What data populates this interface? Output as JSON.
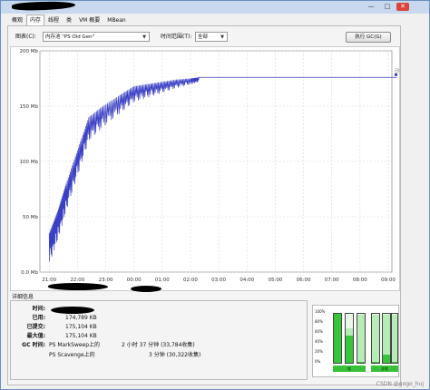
{
  "window": {
    "minimize": "—",
    "maximize": "□",
    "close": "✕"
  },
  "tabs": [
    {
      "label": "概观",
      "active": false
    },
    {
      "label": "内存",
      "active": true
    },
    {
      "label": "线程",
      "active": false
    },
    {
      "label": "类",
      "active": false
    },
    {
      "label": "VM 概要",
      "active": false
    },
    {
      "label": "MBean",
      "active": false
    }
  ],
  "controls": {
    "chart_label": "图表(C):",
    "chart_value": "内存池 \"PS Old Gen\"",
    "range_label": "时间范围(T):",
    "range_value": "全部",
    "gc_button": "执行 GC(G)"
  },
  "chart_data": {
    "type": "line",
    "yticks": [
      "200 Mb",
      "150 Mb",
      "100 Mb",
      "50 Mb",
      "0.0 Mb"
    ],
    "ylim": [
      0,
      200
    ],
    "xticks": [
      "21:00",
      "22:00",
      "23:00",
      "00:00",
      "01:00",
      "02:00",
      "03:00",
      "04:00",
      "05:00",
      "06:00",
      "07:00",
      "08:00",
      "09:00"
    ],
    "legend": {
      "name": "已用",
      "value": "175,104,592"
    },
    "series_color": "#3a3fc4",
    "series": [
      {
        "name": "已用",
        "x_hours": [
          0,
          0.3,
          0.6,
          1.0,
          1.4,
          1.9,
          2.5,
          3.0,
          3.5,
          4.0,
          4.5,
          5.0,
          5.3,
          6.0,
          7.0,
          8.0,
          9.0,
          10.0,
          11.0,
          11.5,
          12.0,
          12.3
        ],
        "y_mb": [
          35,
          55,
          80,
          110,
          140,
          150,
          160,
          168,
          170,
          172,
          174,
          175,
          176,
          176,
          176,
          176,
          176,
          176,
          176,
          176,
          176,
          176
        ]
      }
    ]
  },
  "details": {
    "header": "详细信息",
    "time_label": "时间:",
    "used_label": "已用:",
    "used_value": "174,789 KB",
    "committed_label": "已提交:",
    "committed_value": "175,104 KB",
    "max_label": "最大值:",
    "max_value": "175,104 KB",
    "gc_label": "GC 时间:",
    "gc1_name": "PS MarkSweep上的",
    "gc1_value": "2 小时 37 分钟 (33,784收集)",
    "gc2_name": "PS Scavenge上的",
    "gc2_value": "3 分钟 (30,322收集)"
  },
  "bars": {
    "ticks": [
      "100%",
      "80%",
      "60%",
      "40%",
      "20%",
      "0%"
    ],
    "heap_label": "堆",
    "nonheap_label": "非堆",
    "heap": [
      {
        "used": 1.0,
        "committed": 1.0
      },
      {
        "used": 0.55,
        "committed": 0.7
      },
      {
        "used": 0.02,
        "committed": 0.98
      }
    ],
    "nonheap": [
      {
        "used": 0.02,
        "committed": 0.98
      },
      {
        "used": 0.16,
        "committed": 0.98
      },
      {
        "used": 0.02,
        "committed": 0.98
      }
    ]
  },
  "watermark": "CSDN @gogo_huj"
}
